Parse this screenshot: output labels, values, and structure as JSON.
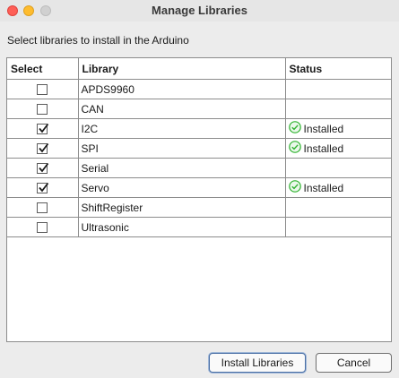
{
  "window": {
    "title": "Manage Libraries"
  },
  "instructions": "Select libraries to install in the Arduino",
  "table": {
    "headers": {
      "select": "Select",
      "library": "Library",
      "status": "Status"
    },
    "rows": [
      {
        "checked": false,
        "library": "APDS9960",
        "status": ""
      },
      {
        "checked": false,
        "library": "CAN",
        "status": ""
      },
      {
        "checked": true,
        "library": "I2C",
        "status": "Installed"
      },
      {
        "checked": true,
        "library": "SPI",
        "status": "Installed"
      },
      {
        "checked": true,
        "library": "Serial",
        "status": ""
      },
      {
        "checked": true,
        "library": "Servo",
        "status": "Installed"
      },
      {
        "checked": false,
        "library": "ShiftRegister",
        "status": ""
      },
      {
        "checked": false,
        "library": "Ultrasonic",
        "status": ""
      }
    ]
  },
  "buttons": {
    "install": "Install Libraries",
    "cancel": "Cancel"
  },
  "colors": {
    "installed_icon": "#2fb32f",
    "close": "#fe5f57",
    "minimize": "#febc2e"
  }
}
